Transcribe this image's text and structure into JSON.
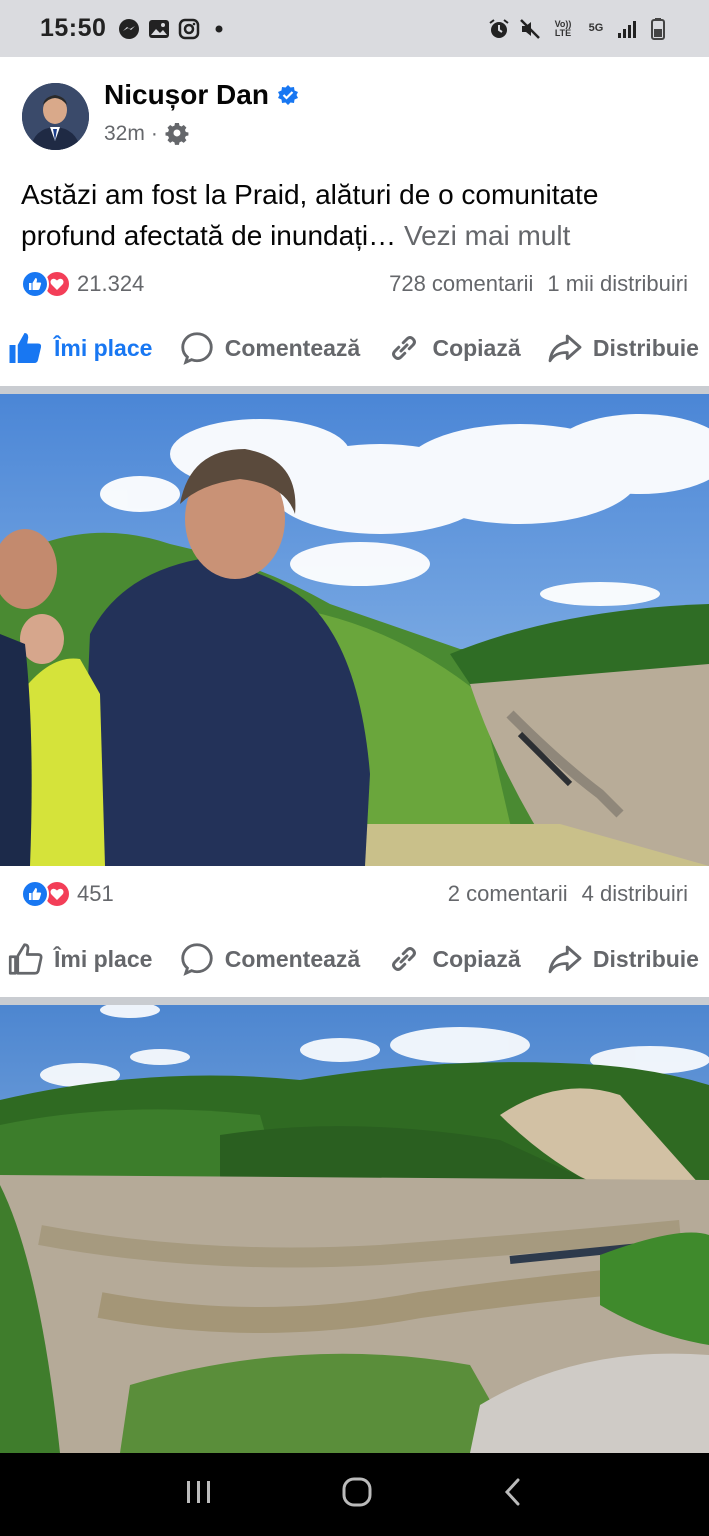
{
  "status_bar": {
    "time": "15:50",
    "left_icons": [
      "messenger-icon",
      "gallery-icon",
      "instagram-icon",
      "dot-icon"
    ],
    "right_icons": [
      "alarm-icon",
      "mute-icon",
      "volte-icon",
      "5g-icon",
      "signal-icon",
      "battery-icon"
    ],
    "volte_label": "Vo)) LTE",
    "net_label": "5G"
  },
  "post": {
    "author": "Nicușor Dan",
    "verified": true,
    "time": "32m",
    "separator": "·",
    "text": "Astăzi am fost la Praid, alături de o comunitate profund afectată de inundați…",
    "see_more": "Vezi mai mult",
    "reaction_count": "21.324",
    "comments": "728 comentarii",
    "shares": "1 mii distribuiri"
  },
  "actions": {
    "like": "Îmi place",
    "comment": "Comentează",
    "copy": "Copiază",
    "share": "Distribuie"
  },
  "photo1": {
    "reaction_count": "451",
    "comments": "2 comentarii",
    "shares": "4 distribuiri"
  },
  "colors": {
    "accent": "#1877f2",
    "love": "#f33e58",
    "muted_text": "#65676b",
    "divider": "#c9ccd1"
  }
}
